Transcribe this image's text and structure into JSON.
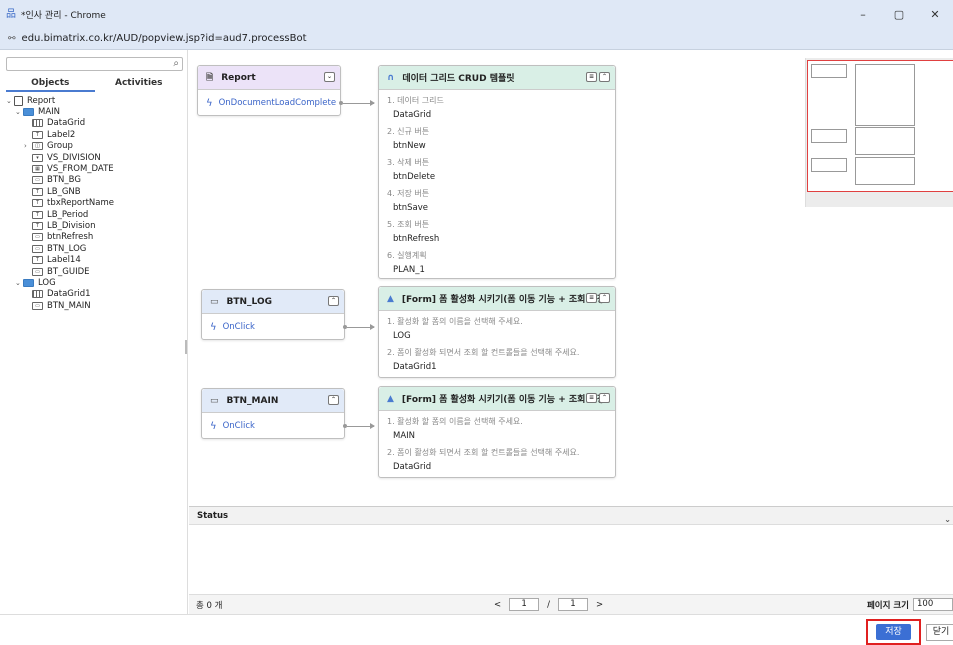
{
  "window": {
    "title": "*인사 관리 - Chrome",
    "url": "edu.bimatrix.co.kr/AUD/popview.jsp?id=aud7.processBot",
    "buttons": [
      "–",
      "▢",
      "✕"
    ]
  },
  "left": {
    "search_placeholder": "",
    "tabs": [
      "Objects",
      "Activities"
    ],
    "tree": [
      {
        "label": "Report",
        "depth": 0,
        "arrow": "⌄",
        "icon": "report-icon"
      },
      {
        "label": "MAIN",
        "depth": 1,
        "arrow": "⌄",
        "icon": "folder-icon"
      },
      {
        "label": "DataGrid",
        "depth": 2,
        "arrow": "",
        "icon": "datagrid-icon"
      },
      {
        "label": "Label2",
        "depth": 2,
        "arrow": "",
        "icon": "label-icon"
      },
      {
        "label": "Group",
        "depth": 2,
        "arrow": "›",
        "icon": "group-icon"
      },
      {
        "label": "VS_DIVISION",
        "depth": 2,
        "arrow": "",
        "icon": "combobox-icon"
      },
      {
        "label": "VS_FROM_DATE",
        "depth": 2,
        "arrow": "",
        "icon": "calendar-icon"
      },
      {
        "label": "BTN_BG",
        "depth": 2,
        "arrow": "",
        "icon": "button-icon"
      },
      {
        "label": "LB_GNB",
        "depth": 2,
        "arrow": "",
        "icon": "label-icon"
      },
      {
        "label": "tbxReportName",
        "depth": 2,
        "arrow": "",
        "icon": "textbox-icon"
      },
      {
        "label": "LB_Period",
        "depth": 2,
        "arrow": "",
        "icon": "label-icon"
      },
      {
        "label": "LB_Division",
        "depth": 2,
        "arrow": "",
        "icon": "label-icon"
      },
      {
        "label": "btnRefresh",
        "depth": 2,
        "arrow": "",
        "icon": "button-icon"
      },
      {
        "label": "BTN_LOG",
        "depth": 2,
        "arrow": "",
        "icon": "button-icon"
      },
      {
        "label": "Label14",
        "depth": 2,
        "arrow": "",
        "icon": "label-icon"
      },
      {
        "label": "BT_GUIDE",
        "depth": 2,
        "arrow": "",
        "icon": "button-icon"
      },
      {
        "label": "LOG",
        "depth": 1,
        "arrow": "⌄",
        "icon": "folder-icon"
      },
      {
        "label": "DataGrid1",
        "depth": 2,
        "arrow": "",
        "icon": "datagrid-icon"
      },
      {
        "label": "BTN_MAIN",
        "depth": 2,
        "arrow": "",
        "icon": "button-icon"
      }
    ]
  },
  "flow": [
    {
      "object": {
        "title": "Report",
        "event": "OnDocumentLoadComplete",
        "theme": "purple"
      },
      "action": {
        "title": "데이터 그리드 CRUD 템플릿",
        "params": [
          {
            "label": "1. 데이터 그리드",
            "value": "DataGrid"
          },
          {
            "label": "2. 신규 버튼",
            "value": "btnNew"
          },
          {
            "label": "3. 삭제 버튼",
            "value": "btnDelete"
          },
          {
            "label": "4. 저장 버튼",
            "value": "btnSave"
          },
          {
            "label": "5. 조회 버튼",
            "value": "btnRefresh"
          },
          {
            "label": "6. 실행계획",
            "value": "PLAN_1"
          }
        ]
      }
    },
    {
      "object": {
        "title": "BTN_LOG",
        "event": "OnClick",
        "theme": "blue"
      },
      "action": {
        "title": "[Form] 폼 활성화 시키기(폼 이동 기능 + 조회 설정)",
        "params": [
          {
            "label": "1. 활성화 할 폼의 이름을 선택해 주세요.",
            "value": "LOG"
          },
          {
            "label": "2. 폼이 활성화 되면서 조회 할 컨트롤들을 선택해 주세요.",
            "value": "DataGrid1"
          }
        ]
      }
    },
    {
      "object": {
        "title": "BTN_MAIN",
        "event": "OnClick",
        "theme": "blue"
      },
      "action": {
        "title": "[Form] 폼 활성화 시키기(폼 이동 기능 + 조회 설정)",
        "params": [
          {
            "label": "1. 활성화 할 폼의 이름을 선택해 주세요.",
            "value": "MAIN"
          },
          {
            "label": "2. 폼이 활성화 되면서 조회 할 컨트롤들을 선택해 주세요.",
            "value": "DataGrid"
          }
        ]
      }
    }
  ],
  "status": {
    "title": "Status"
  },
  "pager": {
    "count": "총 0 개",
    "page": "1",
    "separator": "/",
    "total_pages": "1",
    "prev": "<",
    "next": ">",
    "page_size_label": "페이지 크기",
    "page_size": "100"
  },
  "footer": {
    "save_label": "저장",
    "close_label": "닫기"
  },
  "colors": {
    "accent": "#3b6fd4",
    "highlight": "#e02020",
    "object_purple": "#ece3f8",
    "object_blue": "#e1eaf8",
    "action_green": "#d9efe6"
  }
}
